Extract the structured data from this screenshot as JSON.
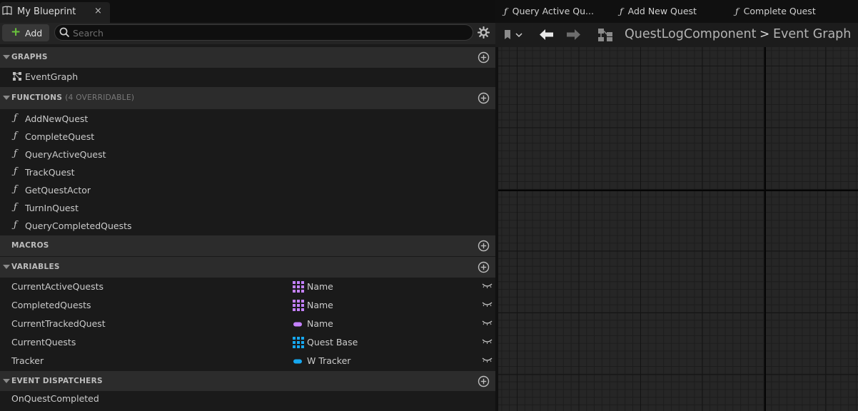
{
  "tab": {
    "title": "My Blueprint",
    "close_glyph": "×"
  },
  "toolbar": {
    "add_label": "Add",
    "search_placeholder": "Search"
  },
  "sections": {
    "graphs": {
      "title": "GRAPHS",
      "items": [
        "EventGraph"
      ]
    },
    "functions": {
      "title": "FUNCTIONS",
      "subtitle": "(4 OVERRIDABLE)",
      "items": [
        "AddNewQuest",
        "CompleteQuest",
        "QueryActiveQuest",
        "TrackQuest",
        "GetQuestActor",
        "TurnInQuest",
        "QueryCompletedQuests"
      ]
    },
    "macros": {
      "title": "MACROS"
    },
    "variables": {
      "title": "VARIABLES",
      "items": [
        {
          "name": "CurrentActiveQuests",
          "type": "Name",
          "kind": "array",
          "color": "#c481ff"
        },
        {
          "name": "CompletedQuests",
          "type": "Name",
          "kind": "array",
          "color": "#c481ff"
        },
        {
          "name": "CurrentTrackedQuest",
          "type": "Name",
          "kind": "single",
          "color": "#c481ff"
        },
        {
          "name": "CurrentQuests",
          "type": "Quest Base",
          "kind": "array",
          "color": "#16a7ef"
        },
        {
          "name": "Tracker",
          "type": "W Tracker",
          "kind": "single",
          "color": "#16a7ef"
        }
      ]
    },
    "event_dispatchers": {
      "title": "EVENT DISPATCHERS",
      "items": [
        "OnQuestCompleted"
      ]
    }
  },
  "graph_tabs": [
    "Query Active Qu...",
    "Add New Quest",
    "Complete Quest"
  ],
  "breadcrumb": {
    "component": "QuestLogComponent",
    "separator": ">",
    "graph": "Event Graph"
  },
  "icons": {
    "function": "ƒ",
    "graph": "graph-icon",
    "add": "plus-circle-icon",
    "visibility": "eye-closed-icon",
    "settings": "gear-icon",
    "bookmark": "bookmark-icon",
    "back": "arrow-left-icon",
    "forward": "arrow-right-icon",
    "hierarchy": "hierarchy-icon"
  },
  "colors": {
    "add_plus": "#6ac53d",
    "name_type": "#c481ff",
    "object_type": "#16a7ef"
  }
}
